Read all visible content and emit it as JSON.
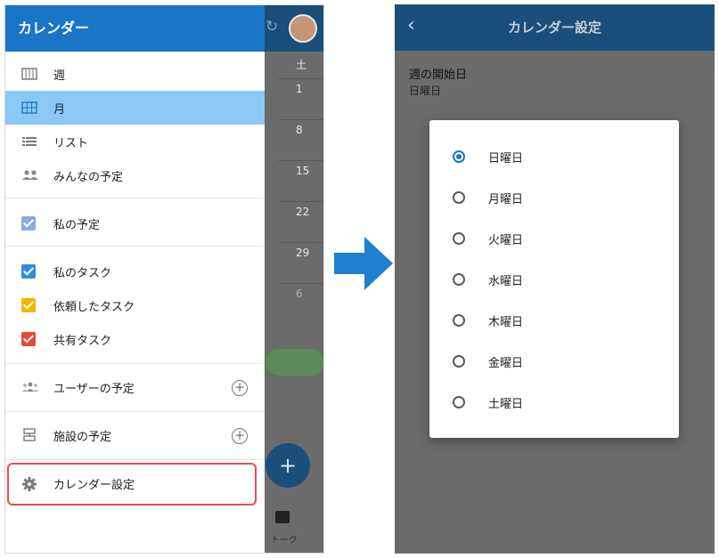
{
  "left_screen": {
    "background": {
      "saturday_header": "土",
      "day_numbers": [
        "1",
        "8",
        "15",
        "22",
        "29",
        "6"
      ],
      "talk_label": "トーク",
      "fab_label": "+"
    },
    "drawer": {
      "title": "カレンダー",
      "view_items": [
        {
          "label": "週",
          "icon": "week-view-icon",
          "active": false
        },
        {
          "label": "月",
          "icon": "month-view-icon",
          "active": true
        },
        {
          "label": "リスト",
          "icon": "list-view-icon",
          "active": false
        },
        {
          "label": "みんなの予定",
          "icon": "people-icon",
          "active": false
        }
      ],
      "my_schedule": {
        "label": "私の予定",
        "checked": true,
        "color": "#8fa8e0"
      },
      "tasks": [
        {
          "label": "私のタスク",
          "checked": true,
          "color": "#2d8fd6"
        },
        {
          "label": "依頼したタスク",
          "checked": true,
          "color": "#f7b500"
        },
        {
          "label": "共有タスク",
          "checked": true,
          "color": "#e64a35"
        }
      ],
      "user_schedule": "ユーザーの予定",
      "facility_schedule": "施設の予定",
      "settings": "カレンダー設定"
    }
  },
  "right_screen": {
    "title": "カレンダー設定",
    "week_start_label": "週の開始日",
    "week_start_value": "日曜日",
    "dialog_options": [
      {
        "label": "日曜日",
        "selected": true
      },
      {
        "label": "月曜日",
        "selected": false
      },
      {
        "label": "火曜日",
        "selected": false
      },
      {
        "label": "水曜日",
        "selected": false
      },
      {
        "label": "木曜日",
        "selected": false
      },
      {
        "label": "金曜日",
        "selected": false
      },
      {
        "label": "土曜日",
        "selected": false
      }
    ]
  },
  "colors": {
    "primary": "#1975c8",
    "header_dark": "#1c4e7a",
    "active_row": "#8cc8f5",
    "highlight": "#e94d4d",
    "arrow": "#1f7fd0"
  }
}
